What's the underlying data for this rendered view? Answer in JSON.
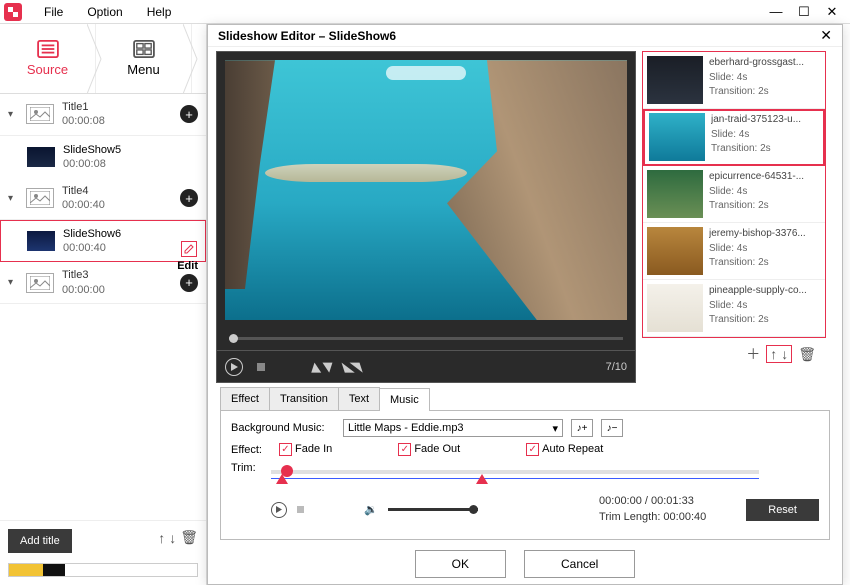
{
  "menubar": {
    "items": [
      "File",
      "Option",
      "Help"
    ]
  },
  "tabs": {
    "source": "Source",
    "menu": "Menu"
  },
  "titles": [
    {
      "name": "Title1",
      "dur": "00:00:08",
      "exp": true,
      "thumb": "placeholder",
      "slides": [
        {
          "name": "SlideShow5",
          "dur": "00:00:08",
          "sel": false,
          "thumb": "night"
        }
      ]
    },
    {
      "name": "Title4",
      "dur": "00:00:40",
      "exp": true,
      "thumb": "placeholder",
      "slides": [
        {
          "name": "SlideShow6",
          "dur": "00:00:40",
          "sel": true,
          "thumb": "card"
        }
      ]
    },
    {
      "name": "Title3",
      "dur": "00:00:00",
      "exp": true,
      "thumb": "placeholder",
      "slides": []
    }
  ],
  "edit_label": "Edit",
  "add_title": "Add title",
  "editor": {
    "title": "Slideshow Editor   –   SlideShow6",
    "counter": "7/10",
    "slides": [
      {
        "name": "eberhard-grossgast...",
        "slide": "Slide: 4s",
        "trans": "Transition: 2s",
        "bg": "linear-gradient(#1a1e26,#2b333f)",
        "sel": false
      },
      {
        "name": "jan-traid-375123-u...",
        "slide": "Slide: 4s",
        "trans": "Transition: 2s",
        "bg": "linear-gradient(#2fb1c8,#0f7a9a)",
        "sel": true
      },
      {
        "name": "epicurrence-64531-...",
        "slide": "Slide: 4s",
        "trans": "Transition: 2s",
        "bg": "linear-gradient(#2e6b3f,#6a8f55)",
        "sel": false
      },
      {
        "name": "jeremy-bishop-3376...",
        "slide": "Slide: 4s",
        "trans": "Transition: 2s",
        "bg": "linear-gradient(#b8863d,#8a5a20)",
        "sel": false
      },
      {
        "name": "pineapple-supply-co...",
        "slide": "Slide: 4s",
        "trans": "Transition: 2s",
        "bg": "linear-gradient(#f4f1ea,#e5e0d4)",
        "sel": false
      }
    ],
    "music_tabs": [
      "Effect",
      "Transition",
      "Text",
      "Music"
    ],
    "active_music_tab": 3,
    "bg_label": "Background Music:",
    "bg_file": "Little Maps - Eddie.mp3",
    "effect_label": "Effect:",
    "effects": {
      "fadein": "Fade In",
      "fadeout": "Fade Out",
      "auto": "Auto Repeat"
    },
    "trim_label": "Trim:",
    "time_current": "00:00:00 / 00:01:33",
    "trim_length": "Trim Length: 00:00:40",
    "reset": "Reset",
    "ok": "OK",
    "cancel": "Cancel"
  }
}
